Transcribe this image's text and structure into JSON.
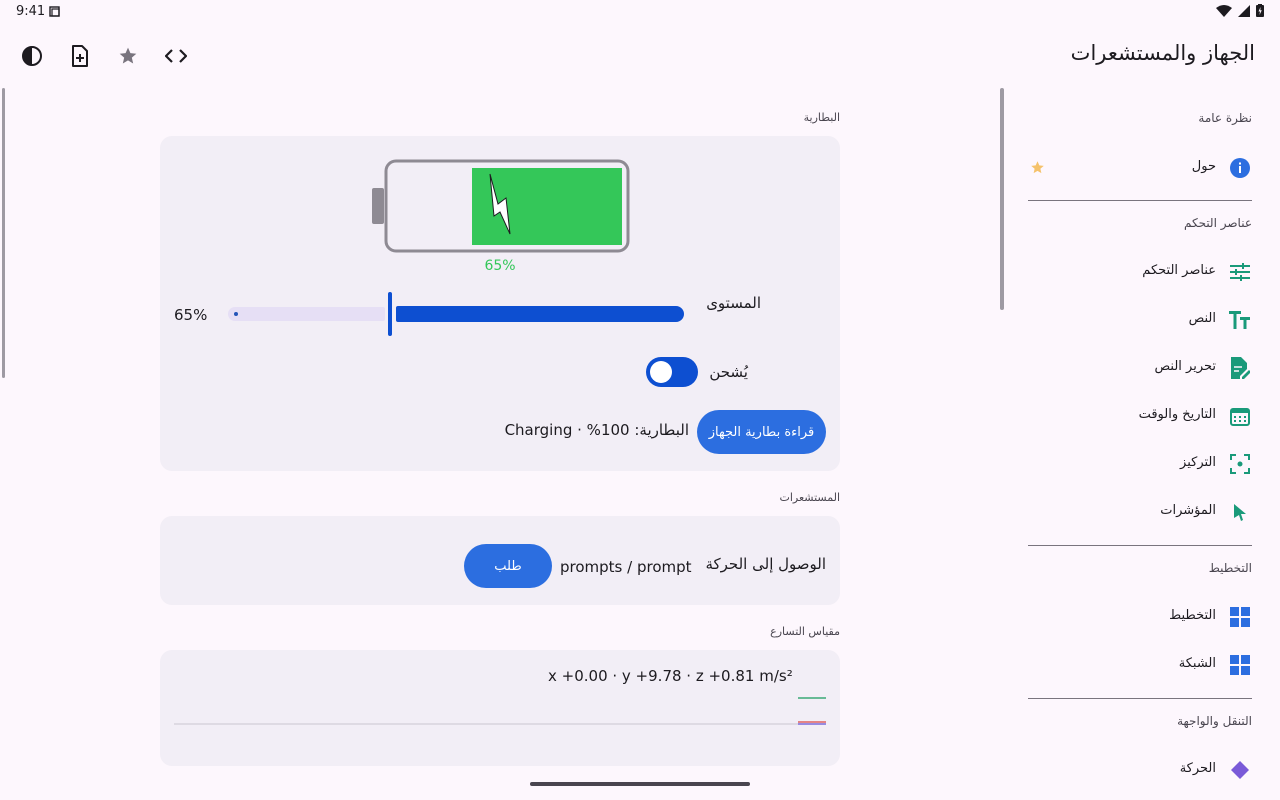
{
  "status_bar": {
    "time": "9:41"
  },
  "header": {
    "title": "الجهاز والمستشعرات"
  },
  "toolbar": {
    "icons": [
      "contrast-icon",
      "add-page-icon",
      "star-icon",
      "code-icon"
    ]
  },
  "battery_section": {
    "label": "البطارية",
    "percent_caption": "65%",
    "level_label": "المستوى",
    "level_value": "65%",
    "level": 0.65,
    "charging_label": "يُشحن",
    "charging": true,
    "read_button": "قراءة بطارية الجهاز",
    "readout": "البطارية: 100% · Charging",
    "colors": {
      "battery_fill": "#34c759",
      "accent": "#0d4fd1"
    }
  },
  "sensors_section": {
    "label": "المستشعرات",
    "motion_label": "الوصول إلى الحركة",
    "motion_value": "prompts / prompt",
    "request_button": "طلب"
  },
  "accelerometer_section": {
    "label": "مقياس التسارع",
    "readout": "x +0.00 · y +9.78 · z +0.81 m/s²"
  },
  "sidebar": {
    "groups": [
      {
        "header": "نظرة عامة",
        "items": [
          {
            "label": "حول",
            "icon": "info-icon",
            "starred": true
          }
        ]
      },
      {
        "header": "عناصر التحكم",
        "items": [
          {
            "label": "عناصر التحكم",
            "icon": "sliders-icon"
          },
          {
            "label": "النص",
            "icon": "text-size-icon"
          },
          {
            "label": "تحرير النص",
            "icon": "edit-document-icon"
          },
          {
            "label": "التاريخ والوقت",
            "icon": "calendar-icon"
          },
          {
            "label": "التركيز",
            "icon": "focus-icon"
          },
          {
            "label": "المؤشرات",
            "icon": "pointer-icon"
          }
        ]
      },
      {
        "header": "التخطيط",
        "items": [
          {
            "label": "التخطيط",
            "icon": "layout-icon"
          },
          {
            "label": "الشبكة",
            "icon": "grid-icon"
          }
        ]
      },
      {
        "header": "التنقل والواجهة",
        "items": [
          {
            "label": "الحركة",
            "icon": "navigation-icon"
          }
        ]
      }
    ]
  }
}
